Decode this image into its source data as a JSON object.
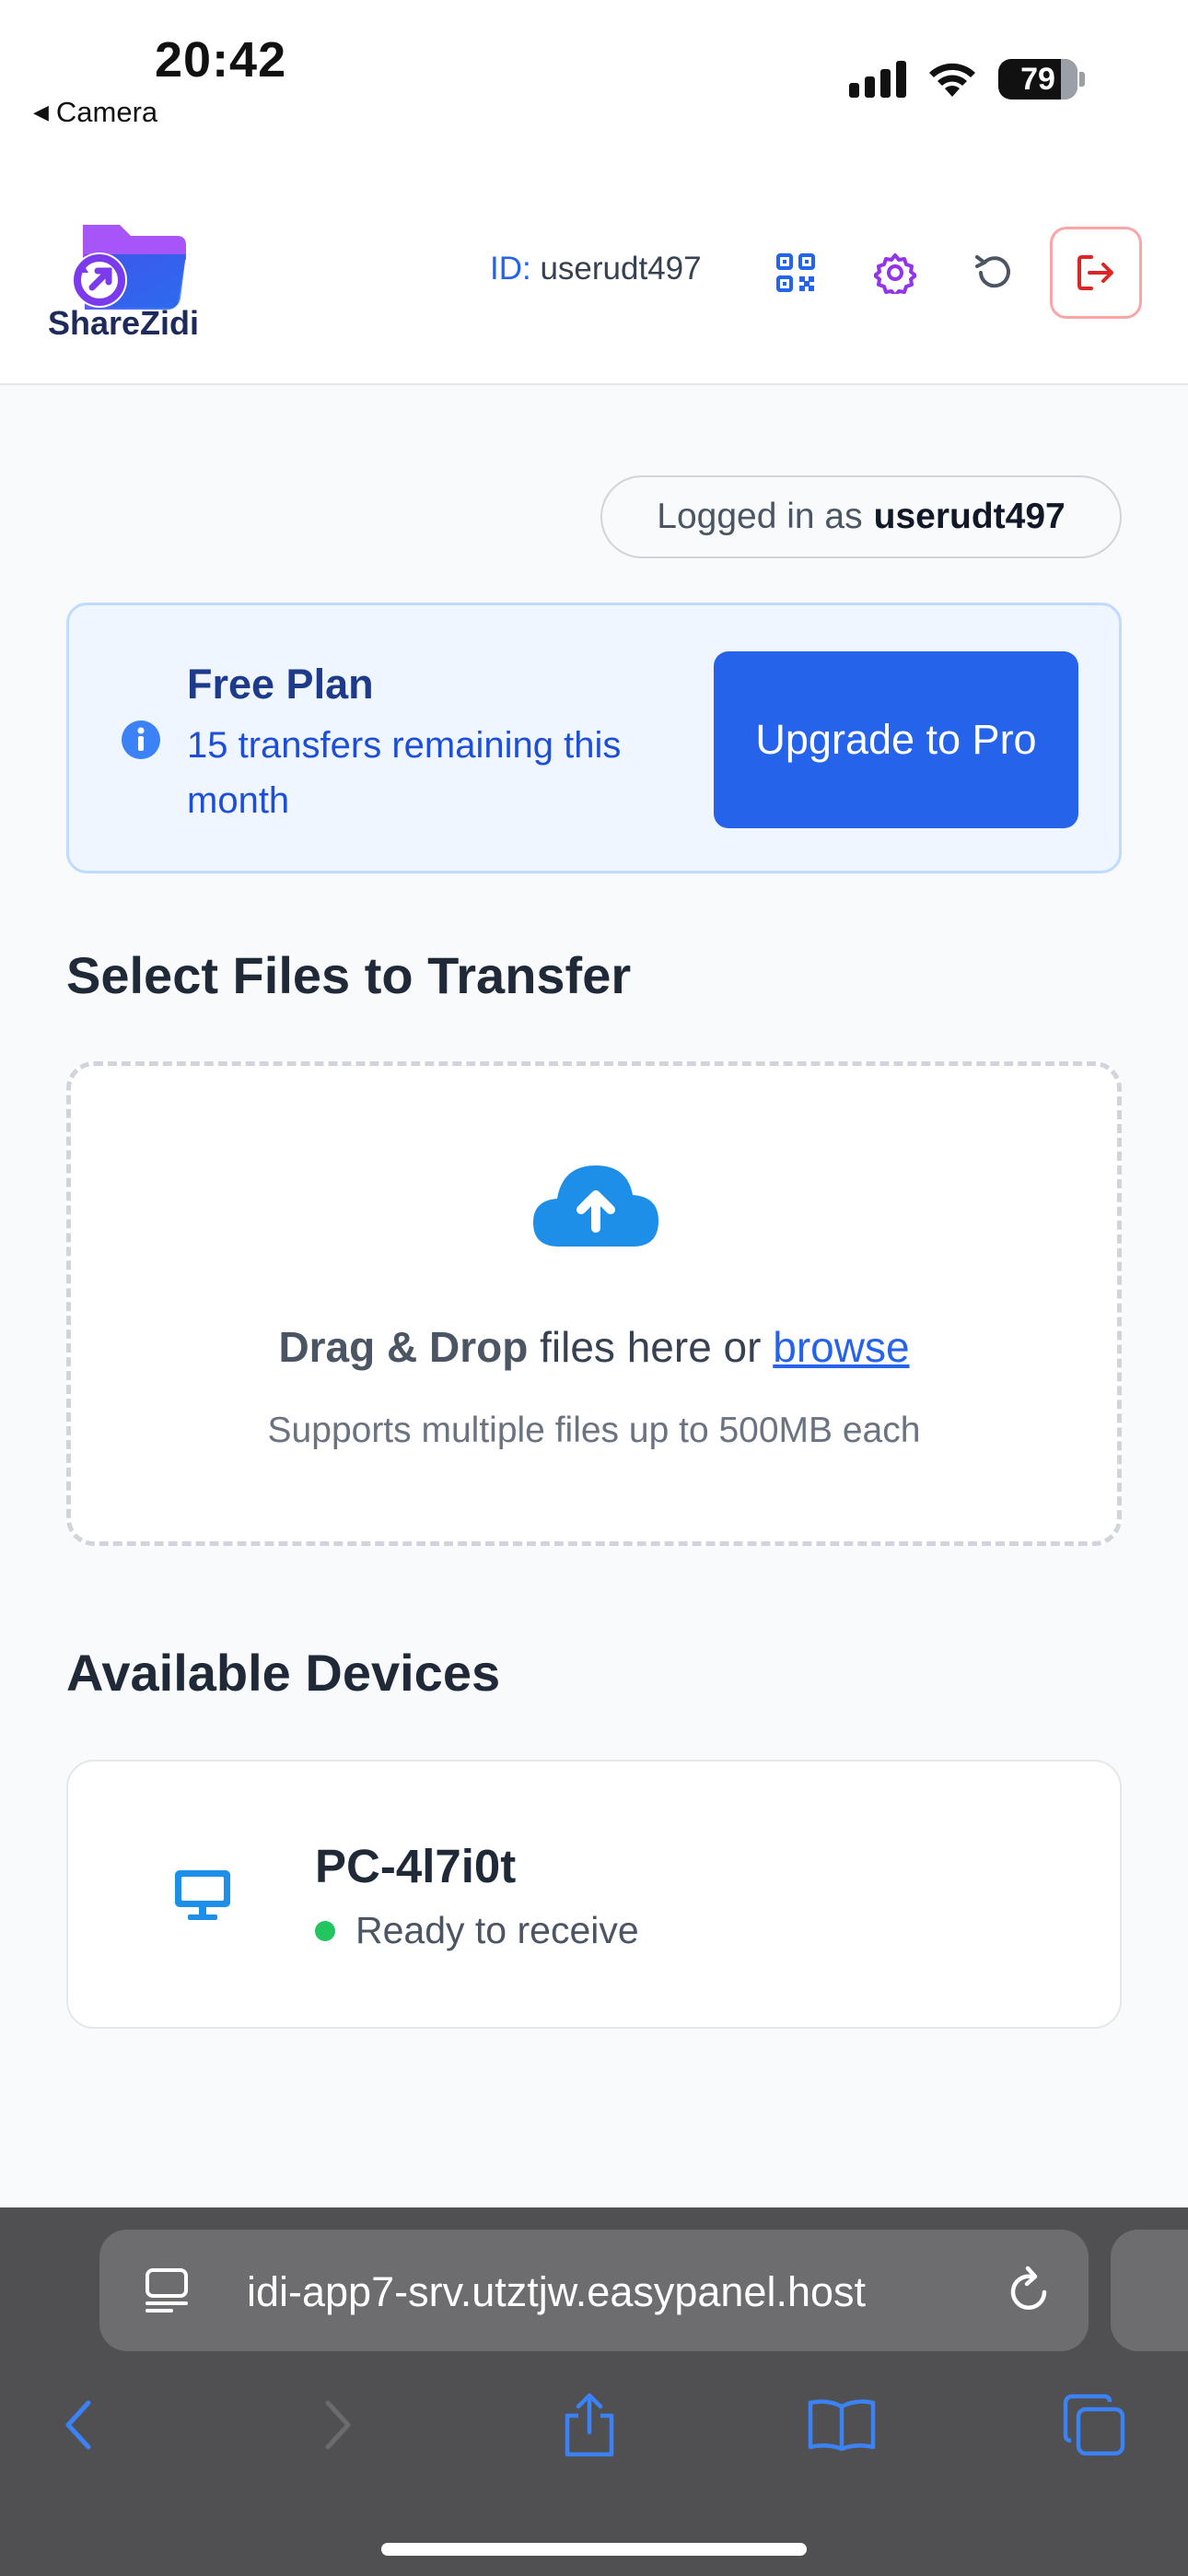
{
  "status_bar": {
    "time": "20:42",
    "back_app": "Camera",
    "battery": "79"
  },
  "header": {
    "logo_text": "ShareZidi",
    "user_id_prefix": "ID:",
    "user_id": "userudt497",
    "icons": [
      "qr-code-icon",
      "gear-icon",
      "history-icon",
      "logout-icon"
    ],
    "accent_color": "#2563eb",
    "gear_color": "#9333ea",
    "logout_color": "#dc2626"
  },
  "session": {
    "logged_in_prefix": "Logged in as",
    "username": "userudt497"
  },
  "plan": {
    "title": "Free Plan",
    "subtitle": "15 transfers remaining this month",
    "upgrade_label": "Upgrade to Pro"
  },
  "upload": {
    "section_title": "Select Files to Transfer",
    "drag_bold": "Drag & Drop",
    "drag_text": " files here or ",
    "browse_link": "browse",
    "support_text": "Supports multiple files up to 500MB each"
  },
  "devices": {
    "section_title": "Available Devices",
    "items": [
      {
        "name": "PC-4l7i0t",
        "status": "Ready to receive",
        "status_color": "#22c55e"
      }
    ]
  },
  "browser": {
    "url": "idi-app7-srv.utztjw.easypanel.host"
  }
}
